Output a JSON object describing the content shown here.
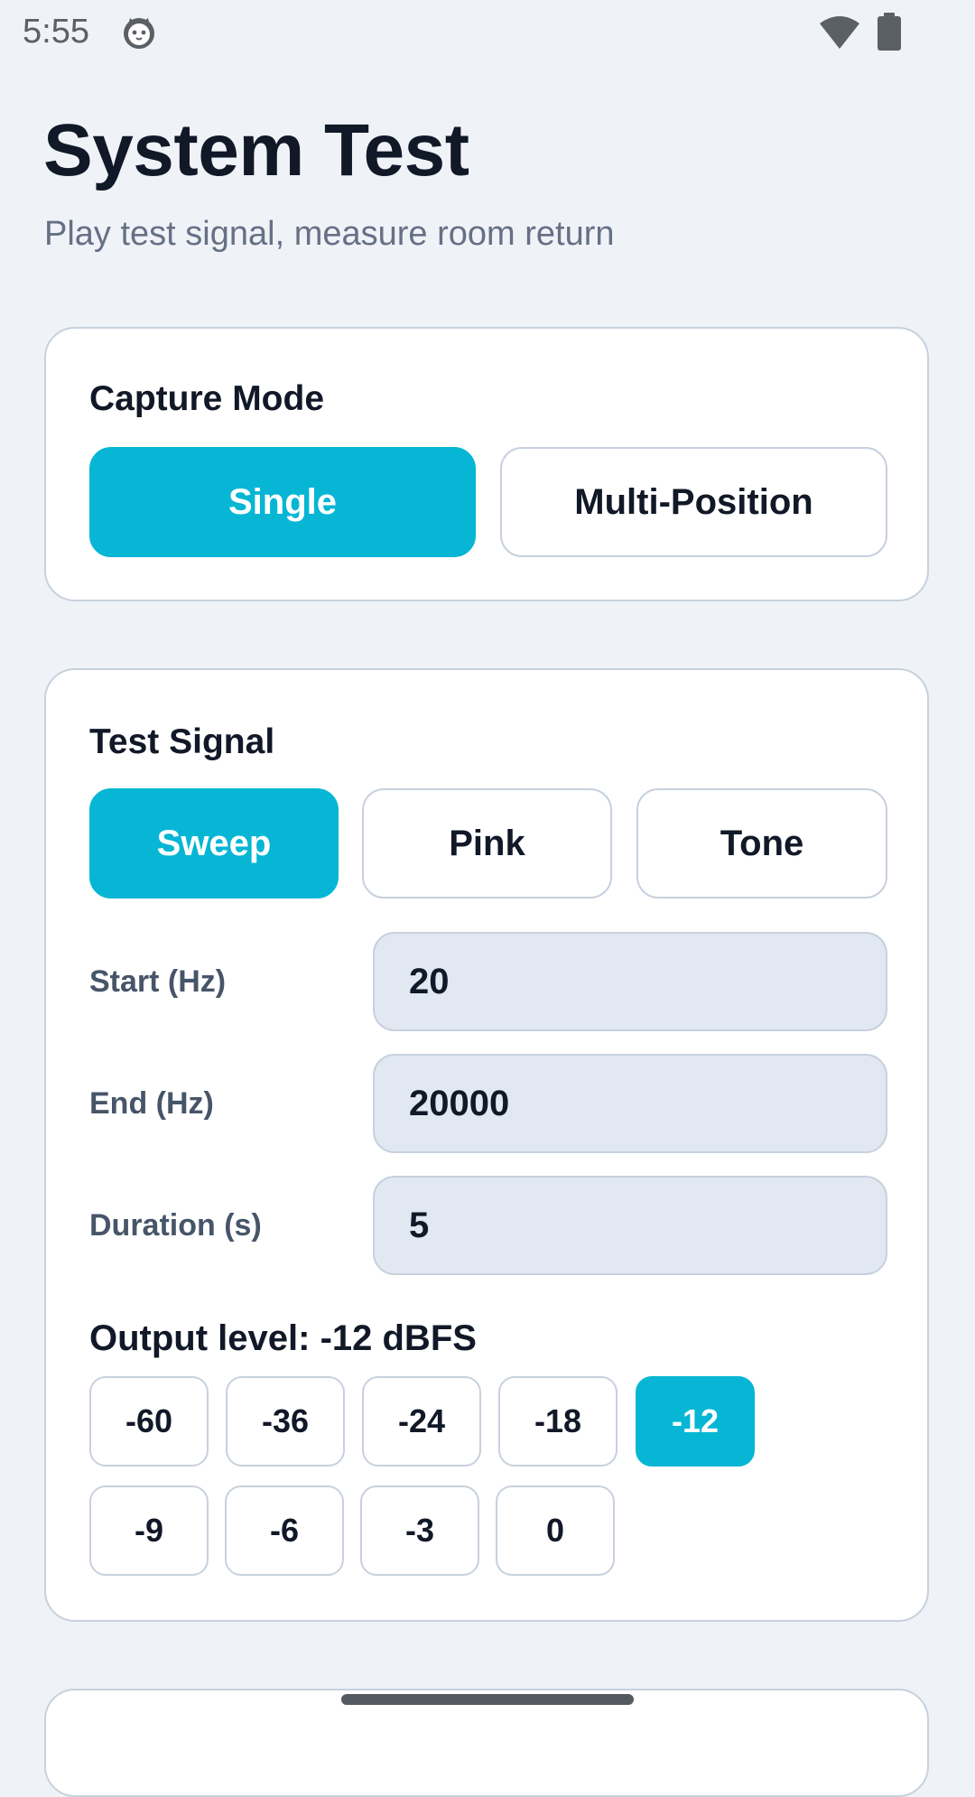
{
  "status_bar": {
    "time": "5:55",
    "icons": [
      "cat-icon",
      "wifi-icon",
      "battery-icon"
    ]
  },
  "header": {
    "title": "System Test",
    "subtitle": "Play test signal, measure room return"
  },
  "capture_mode": {
    "title": "Capture Mode",
    "options": [
      {
        "label": "Single",
        "selected": true
      },
      {
        "label": "Multi-Position",
        "selected": false
      }
    ]
  },
  "test_signal": {
    "title": "Test Signal",
    "options": [
      {
        "label": "Sweep",
        "selected": true
      },
      {
        "label": "Pink",
        "selected": false
      },
      {
        "label": "Tone",
        "selected": false
      }
    ],
    "fields": [
      {
        "label": "Start (Hz)",
        "value": "20"
      },
      {
        "label": "End (Hz)",
        "value": "20000"
      },
      {
        "label": "Duration (s)",
        "value": "5"
      }
    ],
    "output_level_label": "Output level: -12 dBFS",
    "levels": [
      "-60",
      "-36",
      "-24",
      "-18",
      "-12",
      "-9",
      "-6",
      "-3",
      "0"
    ],
    "selected_level": "-12"
  },
  "colors": {
    "accent": "#06b6d4",
    "background": "#eff3f8",
    "card": "#ffffff",
    "input_fill": "#e2e8f1",
    "border": "#c7d1de"
  }
}
